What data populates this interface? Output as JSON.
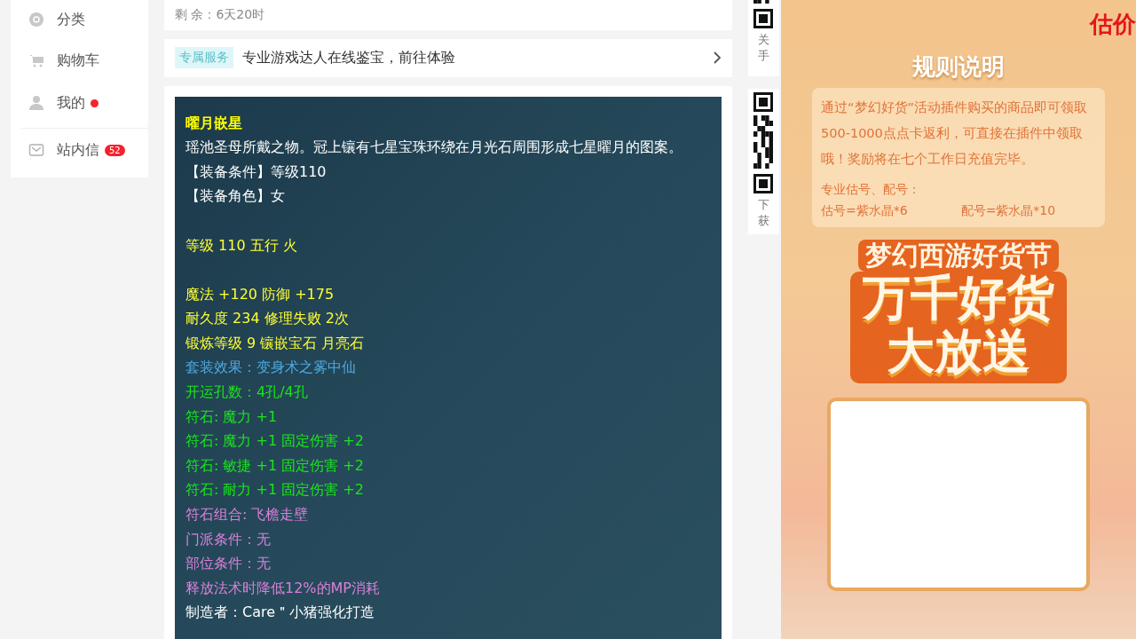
{
  "sidebar": {
    "items": [
      {
        "label": "分类",
        "dot": false
      },
      {
        "label": "购物车",
        "dot": false
      },
      {
        "label": "我的",
        "dot": true
      },
      {
        "label": "站内信",
        "dot": false,
        "badge": "52"
      }
    ]
  },
  "remaining": {
    "label": "剩 余：",
    "value": "6天20时"
  },
  "service": {
    "tag": "专属服务",
    "text": "专业游戏达人在线鉴宝，前往体验"
  },
  "item_panel": {
    "sections": [
      {
        "lines": [
          {
            "text": "曜月嵌星",
            "kind": "title",
            "color": "#ffff00"
          },
          {
            "text": "瑶池圣母所戴之物。冠上镶有七星宝珠环绕在月光石周围形成七星曜月的图案。",
            "kind": "line",
            "color": "#ffffff"
          },
          {
            "text": "【装备条件】等级110",
            "kind": "line",
            "color": "#ffffff"
          },
          {
            "text": "【装备角色】女",
            "kind": "line",
            "color": "#ffffff"
          }
        ]
      },
      {
        "lines": [
          {
            "text": "等级 110 五行 火",
            "kind": "line",
            "color": "#ffff33"
          }
        ]
      },
      {
        "lines": [
          {
            "text": "魔法 +120 防御 +175",
            "kind": "line",
            "color": "#ffff33"
          },
          {
            "text": "耐久度 234 修理失败 2次",
            "kind": "line",
            "color": "#ffff33"
          },
          {
            "text": "锻炼等级 9 镶嵌宝石 月亮石",
            "kind": "line",
            "color": "#ffff33"
          },
          {
            "text": "套装效果：变身术之雾中仙",
            "kind": "line",
            "color": "#4fa9e0"
          },
          {
            "text": "开运孔数：4孔/4孔",
            "kind": "line",
            "color": "#19e619"
          },
          {
            "text": "符石: 魔力 +1",
            "kind": "line",
            "color": "#19e619"
          },
          {
            "text": "符石: 魔力 +1 固定伤害 +2",
            "kind": "line",
            "color": "#19e619"
          },
          {
            "text": "符石: 敏捷 +1 固定伤害 +2",
            "kind": "line",
            "color": "#19e619"
          },
          {
            "text": "符石: 耐力 +1 固定伤害 +2",
            "kind": "line",
            "color": "#19e619"
          },
          {
            "text": "符石组合: 飞檐走壁",
            "kind": "line",
            "color": "#d980d9"
          },
          {
            "text": "门派条件：无",
            "kind": "line",
            "color": "#d980d9"
          },
          {
            "text": "部位条件：无",
            "kind": "line",
            "color": "#d980d9"
          },
          {
            "text": "释放法术时降低12%的MP消耗",
            "kind": "line",
            "color": "#d980d9"
          },
          {
            "text": "制造者：Care＂小猪强化打造",
            "kind": "line",
            "color": "#ffffff"
          }
        ]
      }
    ]
  },
  "qr_column": [
    {
      "lines": [
        "关",
        "手"
      ]
    },
    {
      "lines": [
        "下",
        "获"
      ]
    }
  ],
  "promo": {
    "corner": "估价",
    "rules_title": "规则说明",
    "rules_text": "通过“梦幻好货”活动插件购买的商品即可领取500-1000点点卡返利，可直接在插件中领取哦！奖励将在七个工作日充值完毕。",
    "pro_title": "专业估号、配号：",
    "prices": [
      "估号=紫水晶*6",
      "配号=紫水晶*10"
    ],
    "festival": "梦幻西游好货节",
    "headline": [
      "万千好货",
      "大放送"
    ]
  }
}
